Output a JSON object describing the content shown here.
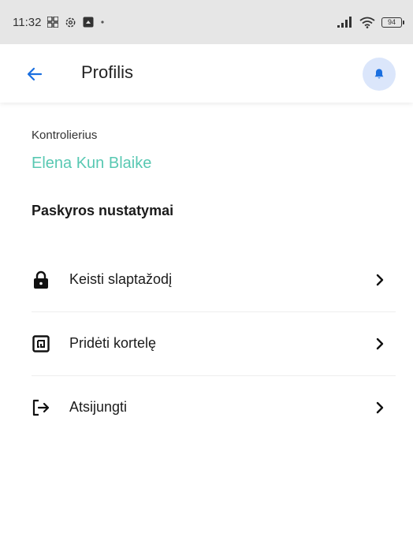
{
  "status_bar": {
    "time": "11:32",
    "battery": "94",
    "icons": [
      "grid-icon",
      "settings-gear-icon",
      "notification-square-icon",
      "dot-icon",
      "signal-icon",
      "wifi-icon",
      "battery-icon"
    ]
  },
  "app_bar": {
    "title": "Profilis",
    "back_icon": "arrow-left-icon",
    "bell_icon": "bell-icon",
    "accent": "#1a6fe0",
    "bell_bg": "#dbe6fb"
  },
  "profile": {
    "role": "Kontrolierius",
    "name": "Elena Kun  Blaike",
    "name_color": "#3bbfa5"
  },
  "section": {
    "title": "Paskyros nustatymai"
  },
  "menu": [
    {
      "label": "Keisti slaptažodį",
      "icon": "lock-icon"
    },
    {
      "label": "Pridėti kortelę",
      "icon": "nfc-card-icon"
    },
    {
      "label": "Atsijungti",
      "icon": "logout-icon"
    }
  ]
}
